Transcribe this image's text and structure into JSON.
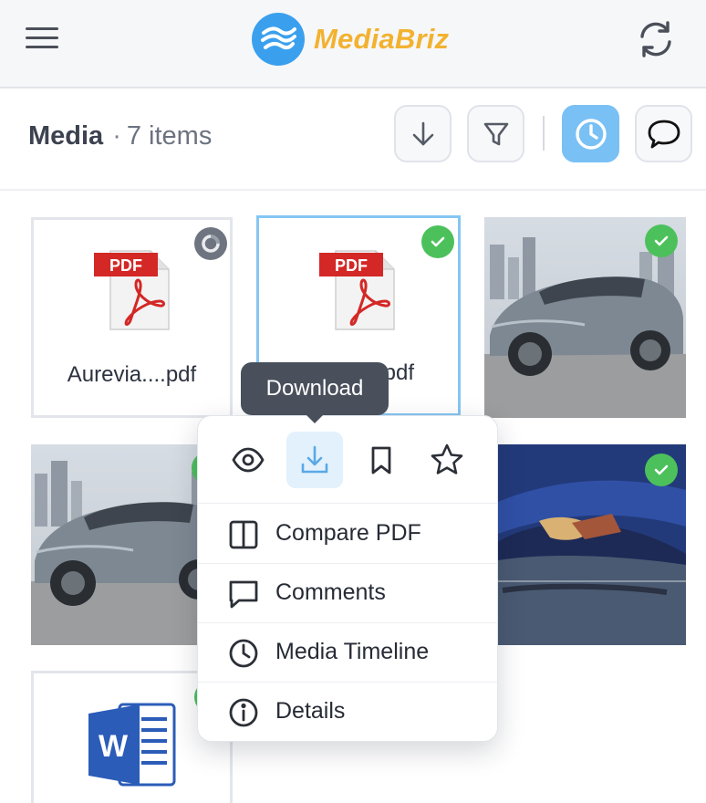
{
  "header": {
    "brand": "MediaBriz",
    "menu_icon": "hamburger-icon",
    "refresh_icon": "refresh-icon",
    "brand_color": "#f2b230",
    "logo_color": "#3aa0ee"
  },
  "toolbar": {
    "title": "Media",
    "separator": "·",
    "count": "7 items",
    "buttons": [
      {
        "icon": "arrow-down-icon",
        "active": false
      },
      {
        "icon": "filter-icon",
        "active": false
      },
      {
        "icon": "clock-icon",
        "active": true
      },
      {
        "icon": "chat-bubble-icon",
        "active": false
      }
    ]
  },
  "media": [
    {
      "kind": "pdf",
      "filename": "Aurevia....pdf",
      "status": "pending"
    },
    {
      "kind": "pdf",
      "filename": ".pdf",
      "status": "done",
      "selected": true
    },
    {
      "kind": "photo",
      "subject": "silver-suv",
      "status": "done"
    },
    {
      "kind": "photo",
      "subject": "silver-suv",
      "status": "done"
    },
    {
      "kind": "photo",
      "subject": "damaged-blue-car",
      "status": "done"
    },
    {
      "kind": "word",
      "status": "done"
    }
  ],
  "file_icons": {
    "pdf_badge": "PDF",
    "word_badge": "W"
  },
  "tooltip": "Download",
  "context_menu": {
    "icons": [
      "eye-icon",
      "download-icon",
      "bookmark-icon",
      "star-icon"
    ],
    "items": [
      {
        "label": "Compare PDF",
        "icon": "columns-icon"
      },
      {
        "label": "Comments",
        "icon": "chat-bubble-icon"
      },
      {
        "label": "Media Timeline",
        "icon": "clock-icon"
      },
      {
        "label": "Details",
        "icon": "info-icon"
      }
    ]
  },
  "colors": {
    "accent": "#79c0f5",
    "success": "#4cc15b",
    "pending": "#6f7580",
    "pdf_red": "#d32826",
    "word_blue": "#2b5cb8"
  }
}
